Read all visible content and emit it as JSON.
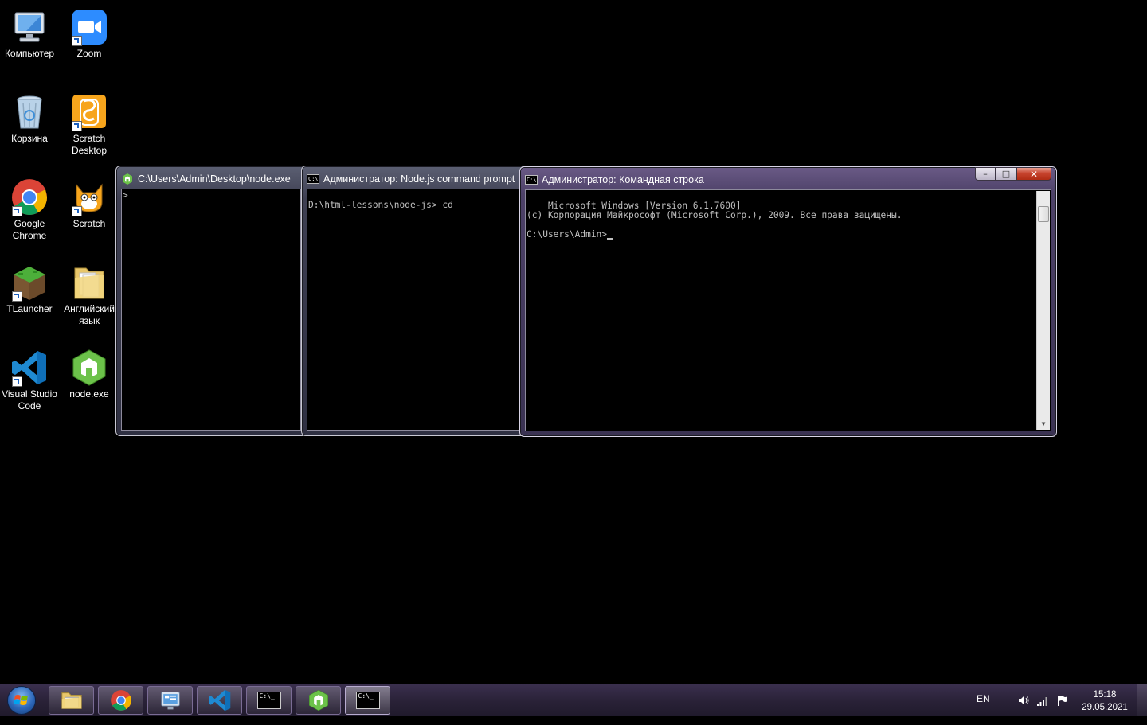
{
  "desktop": {
    "icons": [
      {
        "label": "Компьютер"
      },
      {
        "label": "Zoom"
      },
      {
        "label": "Корзина"
      },
      {
        "label": "Scratch Desktop"
      },
      {
        "label": "Google Chrome"
      },
      {
        "label": "Scratch"
      },
      {
        "label": "TLauncher"
      },
      {
        "label": "Английский язык"
      },
      {
        "label": "Visual Studio Code"
      },
      {
        "label": "node.exe"
      }
    ]
  },
  "windows": {
    "node_repl": {
      "title": "C:\\Users\\Admin\\Desktop\\node.exe",
      "content": ">"
    },
    "node_prompt": {
      "title": "Администратор: Node.js command prompt",
      "content": "\nD:\\html-lessons\\node-js> cd"
    },
    "cmd": {
      "title": "Администратор: Командная строка",
      "content": "Microsoft Windows [Version 6.1.7600]\n(c) Корпорация Майкрософт (Microsoft Corp.), 2009. Все права защищены.\n\nC:\\Users\\Admin>",
      "buttons": {
        "minimize": "–",
        "maximize": "□",
        "close": "✕"
      }
    }
  },
  "taskbar": {
    "buttons": [
      "start-orb",
      "explorer-icon",
      "chrome-icon",
      "control-panel-icon",
      "vscode-icon",
      "cmd-icon",
      "node-icon",
      "cmd-icon"
    ],
    "tray": {
      "language": "EN",
      "time": "15:18",
      "date": "29.05.2021"
    }
  },
  "colors": {
    "desktop_bg": "#000000",
    "taskbar": "#2a2238",
    "active_frame": "#4d4168",
    "console_text": "#c0c0c0"
  }
}
